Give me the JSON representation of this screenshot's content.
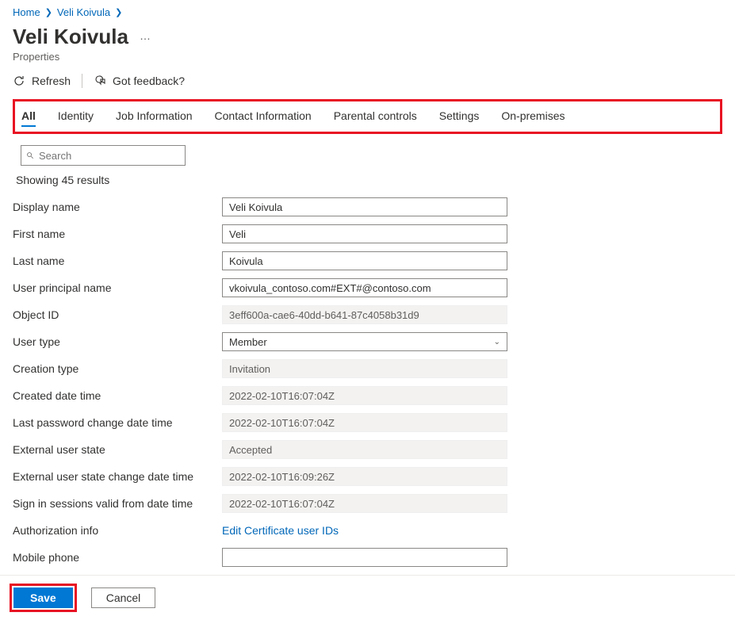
{
  "breadcrumb": {
    "home": "Home",
    "user": "Veli Koivula"
  },
  "header": {
    "title": "Veli Koivula",
    "subtitle": "Properties",
    "more": "…"
  },
  "commands": {
    "refresh": "Refresh",
    "feedback": "Got feedback?"
  },
  "tabs": {
    "all": "All",
    "identity": "Identity",
    "job": "Job Information",
    "contact": "Contact Information",
    "parental": "Parental controls",
    "settings": "Settings",
    "onprem": "On-premises"
  },
  "search": {
    "placeholder": "Search"
  },
  "results_text": "Showing 45 results",
  "labels": {
    "display_name": "Display name",
    "first_name": "First name",
    "last_name": "Last name",
    "upn": "User principal name",
    "object_id": "Object ID",
    "user_type": "User type",
    "creation_type": "Creation type",
    "created_dt": "Created date time",
    "last_pw": "Last password change date time",
    "ext_state": "External user state",
    "ext_state_change": "External user state change date time",
    "signin_valid": "Sign in sessions valid from date time",
    "auth_info": "Authorization info",
    "mobile": "Mobile phone"
  },
  "values": {
    "display_name": "Veli Koivula",
    "first_name": "Veli",
    "last_name": "Koivula",
    "upn": "vkoivula_contoso.com#EXT#@contoso.com",
    "object_id": "3eff600a-cae6-40dd-b641-87c4058b31d9",
    "user_type": "Member",
    "creation_type": "Invitation",
    "created_dt": "2022-02-10T16:07:04Z",
    "last_pw": "2022-02-10T16:07:04Z",
    "ext_state": "Accepted",
    "ext_state_change": "2022-02-10T16:09:26Z",
    "signin_valid": "2022-02-10T16:07:04Z",
    "auth_info": "Edit Certificate user IDs",
    "mobile": ""
  },
  "footer": {
    "save": "Save",
    "cancel": "Cancel"
  }
}
